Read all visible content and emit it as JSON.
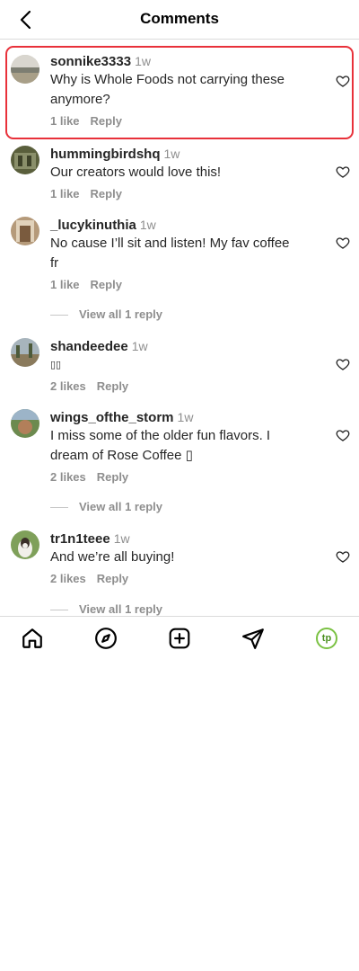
{
  "header": {
    "title": "Comments"
  },
  "comments": [
    {
      "user": "sonnike3333",
      "time": "1w",
      "text_lines": [
        "Why is Whole Foods not carrying these",
        "anymore?"
      ],
      "likes": "1 like",
      "reply": "Reply"
    },
    {
      "user": "hummingbirdshq",
      "time": "1w",
      "text_lines": [
        "Our creators would love this!"
      ],
      "likes": "1 like",
      "reply": "Reply"
    },
    {
      "user": "_lucykinuthia",
      "time": "1w",
      "text_lines": [
        "No cause I’ll sit and listen! My fav coffee",
        "fr"
      ],
      "likes": "1 like",
      "reply": "Reply",
      "view_replies": "View all 1 reply"
    },
    {
      "user": "shandeedee",
      "time": "1w",
      "text_lines": [
        "⁣⁣"
      ],
      "likes": "2 likes",
      "reply": "Reply"
    },
    {
      "user": "wings_ofthe_storm",
      "time": "1w",
      "text_lines": [
        "I miss some of the older fun flavors. I",
        "dream of Rose Coffee ▯"
      ],
      "likes": "2 likes",
      "reply": "Reply",
      "view_replies": "View all 1 reply"
    },
    {
      "user": "tr1n1teee",
      "time": "1w",
      "text_lines": [
        "And we’re all buying!"
      ],
      "likes": "2 likes",
      "reply": "Reply",
      "view_replies": "View all 1 reply"
    }
  ],
  "special": {
    "shandeedee_text": "▯▯"
  },
  "bottom_nav": {
    "profile_initials": "tp"
  },
  "colors": {
    "highlight": "#e8313a",
    "profile_ring": "#7ac142",
    "muted_text": "#8e8e8e"
  },
  "icons": [
    "back-arrow-icon",
    "heart-icon",
    "home-icon",
    "explore-compass-icon",
    "create-plus-icon",
    "direct-send-icon",
    "profile-avatar-icon"
  ]
}
